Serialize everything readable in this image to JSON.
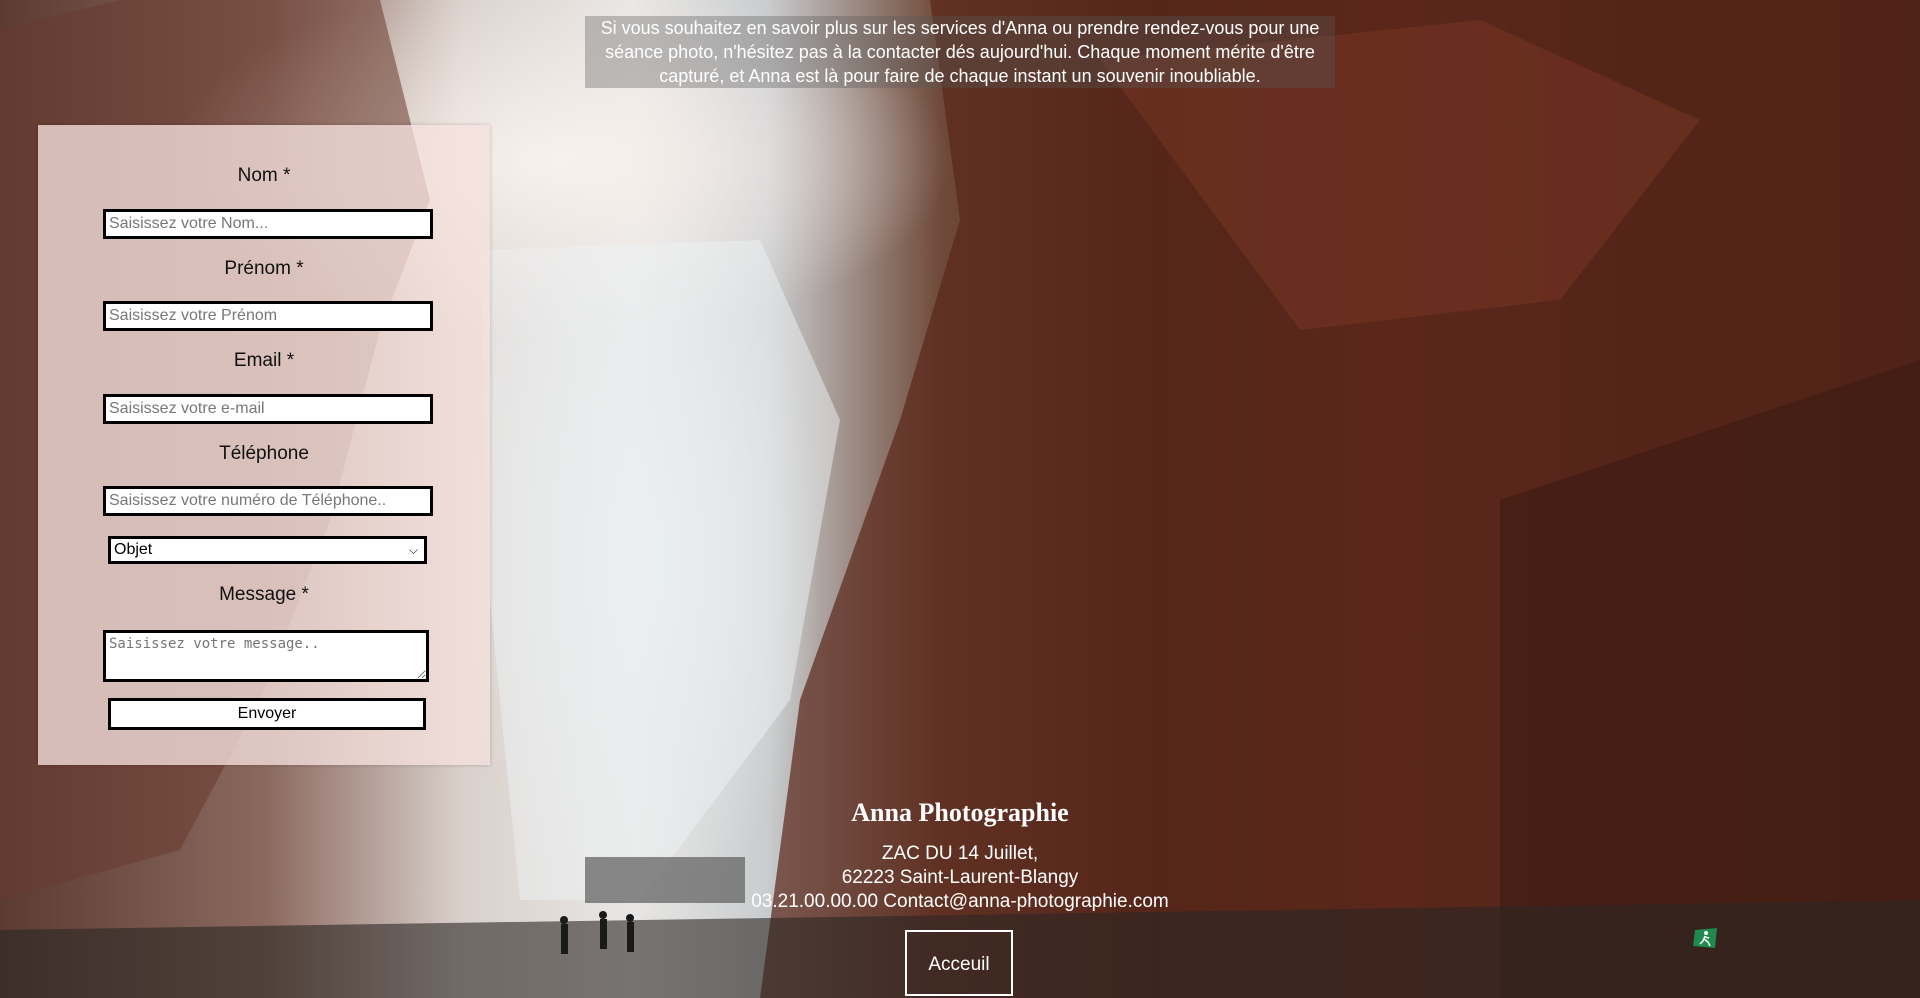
{
  "intro": {
    "text": "Si vous souhaitez en savoir plus sur les services d'Anna ou prendre rendez-vous pour une séance photo, n'hésitez pas à la contacter dés aujourd'hui. Chaque moment mérite d'être capturé, et Anna est là pour faire de chaque instant un souvenir inoubliable."
  },
  "form": {
    "nom_label": "Nom *",
    "nom_placeholder": "Saisissez votre Nom...",
    "prenom_label": "Prénom *",
    "prenom_placeholder": "Saisissez votre Prénom",
    "email_label": "Email *",
    "email_placeholder": "Saisissez votre e-mail",
    "telephone_label": "Téléphone",
    "telephone_placeholder": "Saisissez votre numéro de Téléphone..",
    "objet_selected": "Objet",
    "message_label": "Message *",
    "message_placeholder": "Saisissez votre message..",
    "submit_label": "Envoyer"
  },
  "footer": {
    "title": "Anna Photographie",
    "address_line1": "ZAC DU 14 Juillet,",
    "address_line2": "62223 Saint-Laurent-Blangy",
    "contact_line": "03.21.00.00.00 Contact@anna-photographie.com",
    "home_label": "Acceuil"
  },
  "icons": {
    "select_chevron": "chevron-down-icon",
    "exit_sign": "emergency-exit-icon"
  },
  "colors": {
    "panel_bg": "#f5e0dc",
    "rock": "#5c2a1d",
    "text_light": "#ffffff"
  }
}
